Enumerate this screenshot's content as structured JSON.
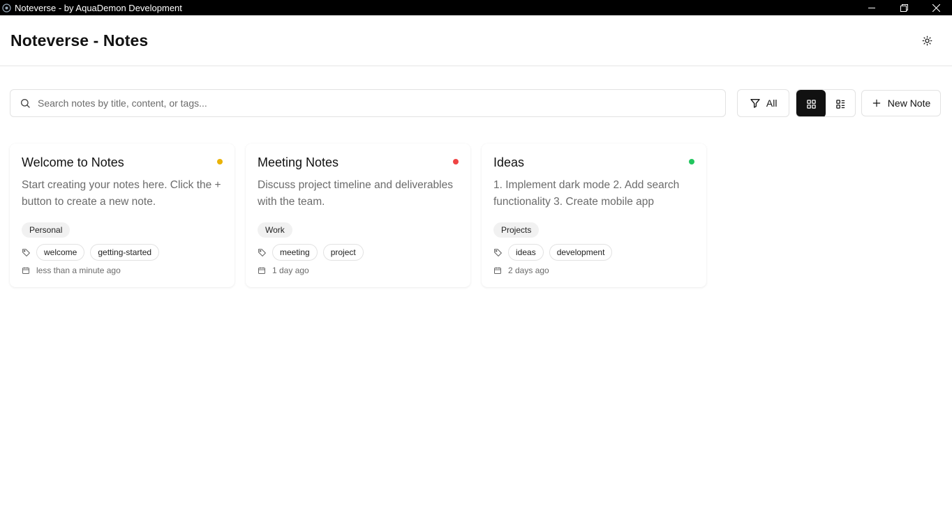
{
  "window": {
    "title": "Noteverse - by AquaDemon Development",
    "controls": [
      "minimize-icon",
      "restore-icon",
      "close-icon"
    ]
  },
  "header": {
    "title": "Noteverse - Notes",
    "theme_icon": "sun-icon"
  },
  "toolbar": {
    "search_placeholder": "Search notes by title, content, or tags...",
    "filter_label": "All",
    "view_active": "grid",
    "new_note_label": "New Note"
  },
  "notes": [
    {
      "title": "Welcome to Notes",
      "content": "Start creating your notes here. Click the + button to create a new note.",
      "color": "#eab308",
      "category": "Personal",
      "tags": [
        "welcome",
        "getting-started"
      ],
      "date": "less than a minute ago"
    },
    {
      "title": "Meeting Notes",
      "content": "Discuss project timeline and deliverables with the team.",
      "color": "#ef4444",
      "category": "Work",
      "tags": [
        "meeting",
        "project"
      ],
      "date": "1 day ago"
    },
    {
      "title": "Ideas",
      "content": "1. Implement dark mode 2. Add search functionality 3. Create mobile app",
      "color": "#22c55e",
      "category": "Projects",
      "tags": [
        "ideas",
        "development"
      ],
      "date": "2 days ago"
    }
  ]
}
